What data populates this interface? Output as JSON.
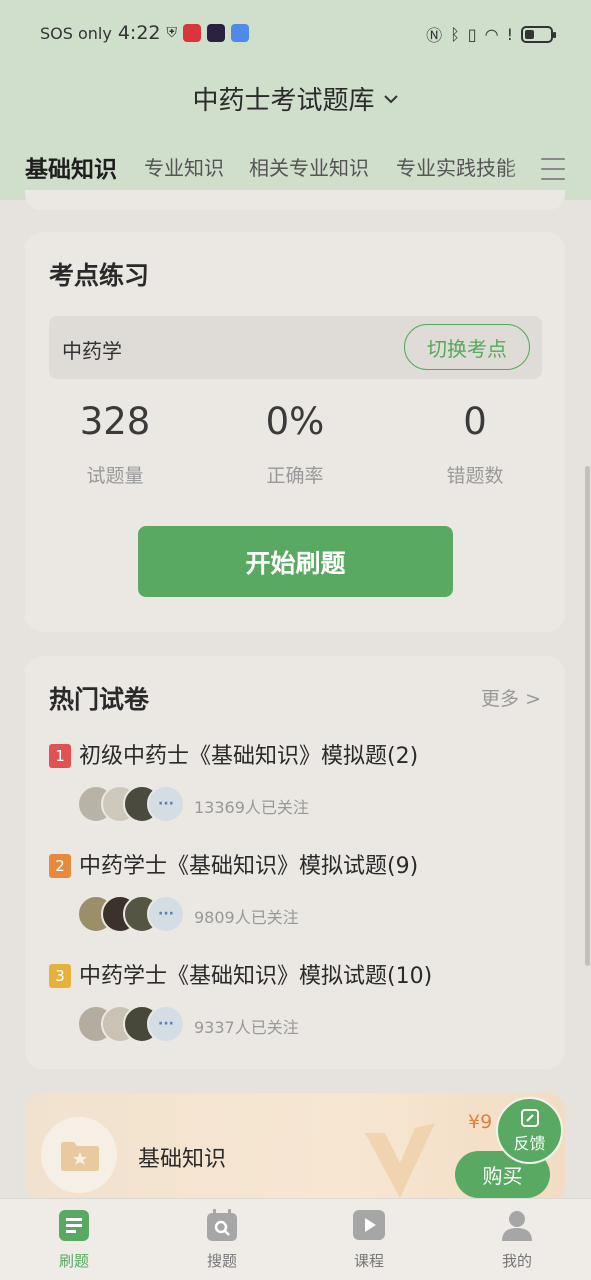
{
  "status_bar": {
    "carrier": "SOS only",
    "time": "4:22"
  },
  "header": {
    "title": "中药士考试题库"
  },
  "tabs": [
    {
      "label": "基础知识",
      "active": true
    },
    {
      "label": "专业知识",
      "active": false
    },
    {
      "label": "相关专业知识",
      "active": false
    },
    {
      "label": "专业实践技能",
      "active": false
    }
  ],
  "practice": {
    "title": "考点练习",
    "subject": "中药学",
    "switch_label": "切换考点",
    "stats": [
      {
        "value": "328",
        "label": "试题量"
      },
      {
        "value": "0%",
        "label": "正确率"
      },
      {
        "value": "0",
        "label": "错题数"
      }
    ],
    "start_label": "开始刷题"
  },
  "papers": {
    "title": "热门试卷",
    "more_label": "更多 >",
    "items": [
      {
        "rank": "1",
        "title": "初级中药士《基础知识》模拟题(2)",
        "followers": "13369人已关注",
        "rank_color": "#e05252"
      },
      {
        "rank": "2",
        "title": "中药学士《基础知识》模拟试题(9)",
        "followers": "9809人已关注",
        "rank_color": "#e58a3c"
      },
      {
        "rank": "3",
        "title": "中药学士《基础知识》模拟试题(10)",
        "followers": "9337人已关注",
        "rank_color": "#e8b13c"
      }
    ]
  },
  "course": {
    "name": "基础知识",
    "price": "¥9",
    "buy_label": "购买"
  },
  "feedback": {
    "label": "反馈"
  },
  "bottom_nav": [
    {
      "label": "刷题",
      "active": true,
      "icon": "doc-icon"
    },
    {
      "label": "搜题",
      "active": false,
      "icon": "search-cal-icon"
    },
    {
      "label": "课程",
      "active": false,
      "icon": "play-icon"
    },
    {
      "label": "我的",
      "active": false,
      "icon": "user-icon"
    }
  ],
  "colors": {
    "accent": "#5aa962",
    "header_bg": "#cfdfcb",
    "price": "#e0803d"
  }
}
